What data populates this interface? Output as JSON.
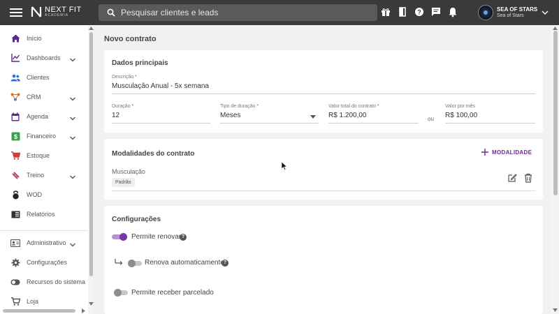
{
  "header": {
    "logo_line1": "NEXT FIT",
    "logo_line2": "ACADEMIA",
    "search_placeholder": "Pesquisar clientes e leads",
    "icons": [
      "gift-icon",
      "door-icon",
      "help-icon",
      "chat-icon",
      "bell-icon"
    ],
    "user_name": "SEA OF STARS",
    "user_sub": "Sea of Stars"
  },
  "sidebar": {
    "items": [
      {
        "label": "Início",
        "icon": "home-icon",
        "color": "#5b2a86",
        "chevron": false
      },
      {
        "label": "Dashboards",
        "icon": "chart-icon",
        "color": "#5b2a86",
        "chevron": true
      },
      {
        "label": "Clientes",
        "icon": "people-icon",
        "color": "#2f6fd6",
        "chevron": false
      },
      {
        "label": "CRM",
        "icon": "crm-icon",
        "color": "#e06f1c",
        "chevron": true
      },
      {
        "label": "Agenda",
        "icon": "calendar-icon",
        "color": "#5b2a86",
        "chevron": true
      },
      {
        "label": "Financeiro",
        "icon": "money-icon",
        "color": "#3aa34a",
        "chevron": true
      },
      {
        "label": "Estoque",
        "icon": "cart-icon",
        "color": "#d33a3a",
        "chevron": false
      },
      {
        "label": "Treino",
        "icon": "dumbbell-icon",
        "color": "#d33a3a",
        "chevron": true
      },
      {
        "label": "WOD",
        "icon": "kettlebell-icon",
        "color": "#222222",
        "chevron": false
      },
      {
        "label": "Relatórios",
        "icon": "report-icon",
        "color": "#333333",
        "chevron": false
      },
      {
        "label": "Administrativo",
        "icon": "id-card-icon",
        "color": "#555555",
        "chevron": true
      },
      {
        "label": "Configurações",
        "icon": "gear-icon",
        "color": "#555555",
        "chevron": false
      },
      {
        "label": "Recursos do sistema",
        "icon": "toggle-icon",
        "color": "#555555",
        "chevron": false
      },
      {
        "label": "Loja",
        "icon": "shop-icon",
        "color": "#555555",
        "chevron": false
      }
    ]
  },
  "main": {
    "page_title": "Novo contrato",
    "dados": {
      "title": "Dados principais",
      "descricao_label": "Descrição *",
      "descricao_value": "Musculação Anual - 5x semana",
      "duracao_label": "Duração *",
      "duracao_value": "12",
      "tipo_label": "Tipo de duração *",
      "tipo_value": "Meses",
      "valor_total_label": "Valor total do contrato *",
      "valor_total_value": "R$ 1.200,00",
      "ou": "ou",
      "valor_mes_label": "Valor por mês",
      "valor_mes_value": "R$ 100,00"
    },
    "modalidades": {
      "title": "Modalidades do contrato",
      "add_label": "MODALIDADE",
      "item_name": "Musculação",
      "item_chip": "Padrão"
    },
    "config": {
      "title": "Configurações",
      "permite_renovar": "Permite renovar",
      "permite_renovar_on": true,
      "renova_auto": "Renova automaticamente",
      "renova_auto_on": false,
      "permite_parcelado": "Permite receber parcelado",
      "permite_parcelado_on": false,
      "help_symbol": "?"
    }
  },
  "colors": {
    "topbar": "#3a3a3a",
    "accent": "#7b33a8",
    "background": "#f1f1f1"
  }
}
